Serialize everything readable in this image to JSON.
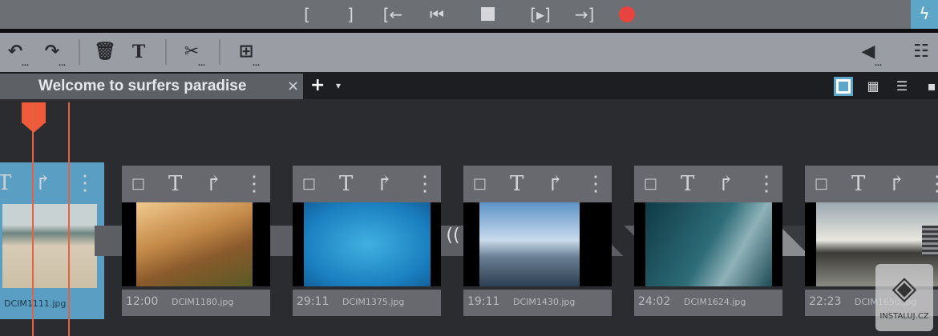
{
  "transport": {
    "icons": [
      "mark-in-icon",
      "mark-out-icon",
      "go-to-in-icon",
      "skip-back-icon",
      "stop-icon",
      "play-range-icon",
      "go-to-out-icon",
      "record-icon",
      "flash-icon"
    ],
    "record_color": "#e8433f",
    "accent": "#5ea6c8"
  },
  "toolbar": {
    "icons": [
      "undo-icon",
      "redo-icon",
      "delete-icon",
      "text-icon",
      "cut-icon",
      "insert-icon",
      "volume-icon",
      "mixer-icon"
    ]
  },
  "tabs": [
    {
      "label": "Welcome to surfers paradise",
      "close": "×"
    }
  ],
  "tab_add": "+",
  "tab_menu": "▾",
  "clips": [
    {
      "time": "",
      "file": "DCIM1111.jpg",
      "selected": true
    },
    {
      "time": "12:00",
      "file": "DCIM1180.jpg"
    },
    {
      "time": "29:11",
      "file": "DCIM1375.jpg"
    },
    {
      "time": "19:11",
      "file": "DCIM1430.jpg"
    },
    {
      "time": "24:02",
      "file": "DCIM1624.jpg"
    },
    {
      "time": "22:23",
      "file": "DCIM1650.jpg"
    }
  ],
  "watermark": "INSTALUJ.CZ"
}
